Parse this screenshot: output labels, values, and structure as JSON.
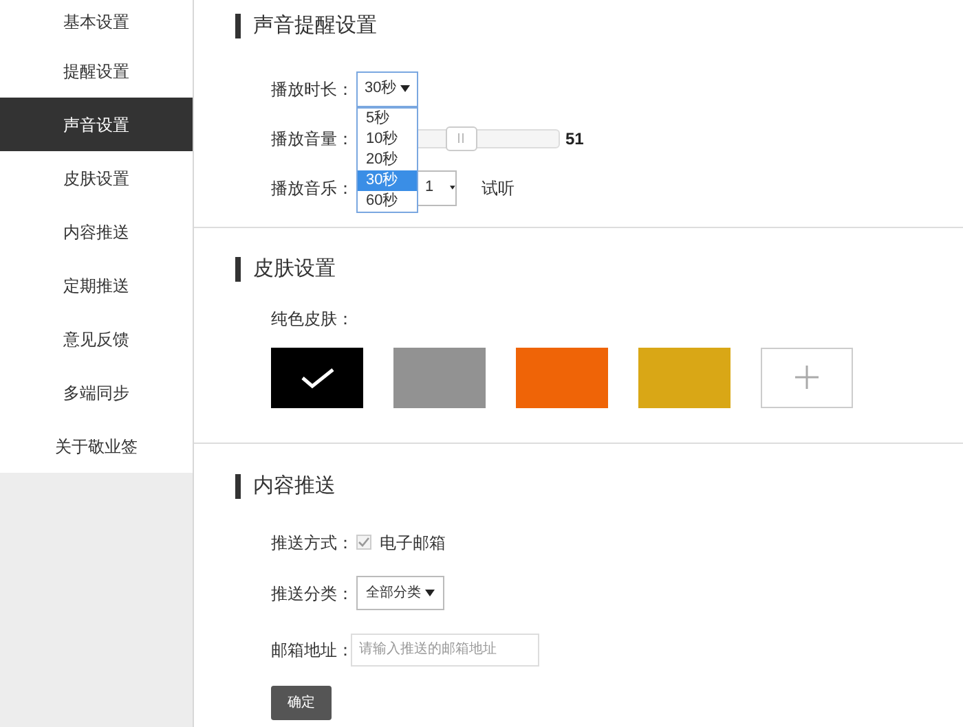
{
  "sidebar": {
    "items": [
      {
        "label": "基本设置",
        "selected": false
      },
      {
        "label": "提醒设置",
        "selected": false
      },
      {
        "label": "声音设置",
        "selected": true
      },
      {
        "label": "皮肤设置",
        "selected": false
      },
      {
        "label": "内容推送",
        "selected": false
      },
      {
        "label": "定期推送",
        "selected": false
      },
      {
        "label": "意见反馈",
        "selected": false
      },
      {
        "label": "多端同步",
        "selected": false
      },
      {
        "label": "关于敬业签",
        "selected": false
      }
    ]
  },
  "sound": {
    "title": "声音提醒设置",
    "duration": {
      "label": "播放时长：",
      "value": "30秒",
      "expanded": true,
      "options": [
        {
          "label": "5秒",
          "selected": false
        },
        {
          "label": "10秒",
          "selected": false
        },
        {
          "label": "20秒",
          "selected": false
        },
        {
          "label": "30秒",
          "selected": true
        },
        {
          "label": "60秒",
          "selected": false
        }
      ]
    },
    "volume": {
      "label": "播放音量：",
      "level": 0.52,
      "reading": "51"
    },
    "music": {
      "label": "播放音乐：",
      "value": "1",
      "preview": "试听"
    }
  },
  "skin": {
    "title": "皮肤设置",
    "label": "纯色皮肤：",
    "swatches": [
      {
        "kind": "color",
        "color": "#000000",
        "selected": true
      },
      {
        "kind": "color",
        "color": "#929292",
        "selected": false
      },
      {
        "kind": "color",
        "color": "#ef6407",
        "selected": false
      },
      {
        "kind": "color",
        "color": "#d9a716",
        "selected": false
      },
      {
        "kind": "add",
        "selected": false
      }
    ]
  },
  "push": {
    "title": "内容推送",
    "method": {
      "label": "推送方式：",
      "option": "电子邮箱",
      "checked": true
    },
    "category": {
      "label": "推送分类：",
      "value": "全部分类"
    },
    "email": {
      "label": "邮箱地址：",
      "placeholder": "请输入推送的邮箱地址"
    },
    "submit": "确定"
  }
}
